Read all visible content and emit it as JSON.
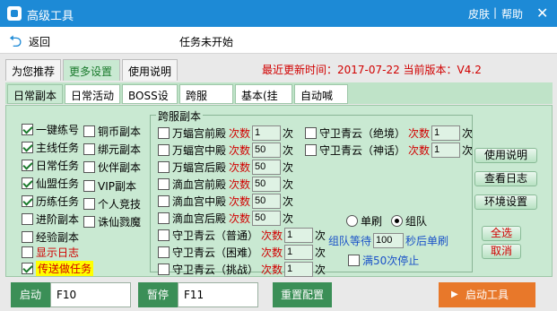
{
  "window": {
    "title": "高级工具",
    "skin": "皮肤",
    "skin_display": "皮肤",
    "separator": "|",
    "help": "帮助",
    "close": "✕"
  },
  "nav": {
    "back": "返回",
    "status": "任务未开始"
  },
  "tabs": [
    "为您推荐",
    "更多设置",
    "使用说明"
  ],
  "version_info": "最近更新时间：2017-07-22 当前版本：V4.2",
  "subtabs": [
    "日常副本",
    "日常活动",
    "BOSS设置",
    "跨服BOSS",
    "基本(挂机)",
    "自动喊话"
  ],
  "left_col1": [
    {
      "label": "一键练号",
      "checked": true
    },
    {
      "label": "主线任务",
      "checked": true
    },
    {
      "label": "日常任务",
      "checked": true
    },
    {
      "label": "仙盟任务",
      "checked": true
    },
    {
      "label": "历练任务",
      "checked": true
    },
    {
      "label": "进阶副本",
      "checked": false
    },
    {
      "label": "经验副本",
      "checked": false
    },
    {
      "label": "显示日志",
      "checked": false
    },
    {
      "label": "传送做任务",
      "checked": true
    }
  ],
  "left_col2": [
    {
      "label": "铜币副本",
      "checked": false
    },
    {
      "label": "绑元副本",
      "checked": false
    },
    {
      "label": "伙伴副本",
      "checked": false
    },
    {
      "label": "VIP副本",
      "checked": false
    },
    {
      "label": "个人竞技",
      "checked": false
    },
    {
      "label": "诛仙戮魔",
      "checked": false
    }
  ],
  "group": {
    "title": "跨服副本",
    "count_label": "次数",
    "unit": "次",
    "left": [
      {
        "label": "万蝠宫前殿",
        "value": "1"
      },
      {
        "label": "万蝠宫中殿",
        "value": "50"
      },
      {
        "label": "万蝠宫后殿",
        "value": "50"
      },
      {
        "label": "滴血宫前殿",
        "value": "50"
      },
      {
        "label": "滴血宫中殿",
        "value": "50"
      },
      {
        "label": "滴血宫后殿",
        "value": "50"
      },
      {
        "label": "守卫青云（普通）",
        "value": "1"
      },
      {
        "label": "守卫青云（困难）",
        "value": "1"
      },
      {
        "label": "守卫青云（挑战）",
        "value": "1"
      }
    ],
    "right": [
      {
        "label": "守卫青云（绝境）",
        "value": "1"
      },
      {
        "label": "守卫青云（神话）",
        "value": "1"
      }
    ],
    "single": "单刷",
    "team": "组队",
    "wait_pre": "组队等待",
    "wait_value": "100",
    "wait_post": "秒后单刷",
    "stop50": "满50次停止"
  },
  "side_buttons": [
    "使用说明",
    "查看日志",
    "环境设置"
  ],
  "select_all": "全选",
  "cancel": "取消",
  "bottom": {
    "start": "启动",
    "start_key": "F10",
    "pause": "暂停",
    "pause_key": "F11",
    "reset": "重置配置",
    "launch": "启动工具"
  }
}
